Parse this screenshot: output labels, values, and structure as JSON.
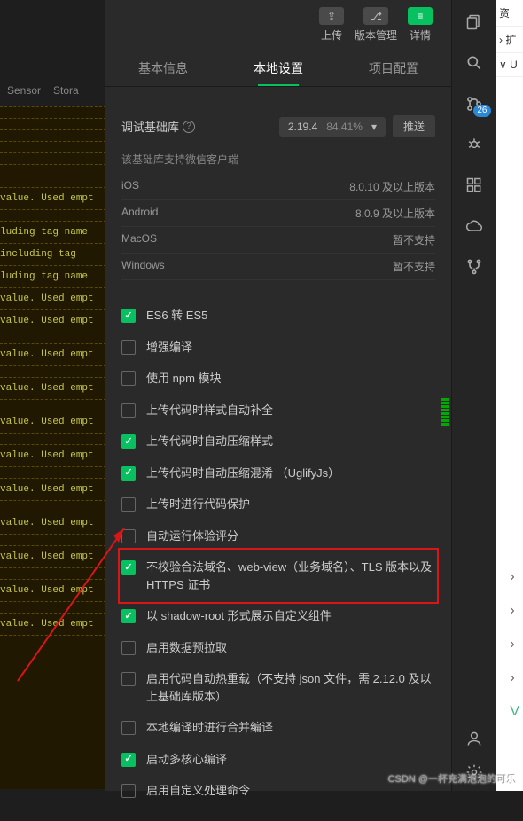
{
  "bgHeader": {
    "c1": "Sensor",
    "c2": "Stora"
  },
  "bgLines": [
    "",
    "",
    "",
    "",
    "",
    "",
    "",
    "value. Used empt",
    "",
    "luding tag name",
    " including tag ",
    "luding tag name",
    "value. Used empt",
    "value. Used empt",
    "",
    "value. Used empt",
    "",
    "value. Used empt",
    "",
    "value. Used empt",
    "",
    "value. Used empt",
    "",
    "value. Used empt",
    "",
    "value. Used empt",
    "",
    "value. Used empt",
    "",
    "value. Used empt",
    "",
    "value. Used empt",
    ""
  ],
  "toolbar": {
    "upload": "上传",
    "version": "版本管理",
    "detail": "详情"
  },
  "tabs": {
    "basic": "基本信息",
    "local": "本地设置",
    "project": "项目配置"
  },
  "debug": {
    "label": "调试基础库",
    "version": "2.19.4",
    "percent": "84.41%",
    "push": "推送"
  },
  "supportText": "该基础库支持微信客户端",
  "platforms": [
    {
      "name": "iOS",
      "req": "8.0.10 及以上版本"
    },
    {
      "name": "Android",
      "req": "8.0.9 及以上版本"
    },
    {
      "name": "MacOS",
      "req": "暂不支持"
    },
    {
      "name": "Windows",
      "req": "暂不支持"
    }
  ],
  "checks": [
    {
      "on": true,
      "label": "ES6 转 ES5"
    },
    {
      "on": false,
      "label": "增强编译"
    },
    {
      "on": false,
      "label": "使用 npm 模块"
    },
    {
      "on": false,
      "label": "上传代码时样式自动补全"
    },
    {
      "on": true,
      "label": "上传代码时自动压缩样式"
    },
    {
      "on": true,
      "label": "上传代码时自动压缩混淆 （UglifyJs）"
    },
    {
      "on": false,
      "label": "上传时进行代码保护"
    },
    {
      "on": false,
      "label": "自动运行体验评分"
    },
    {
      "on": true,
      "label": "不校验合法域名、web-view（业务域名）、TLS 版本以及 HTTPS 证书",
      "highlight": true
    },
    {
      "on": true,
      "label": "以 shadow-root 形式展示自定义组件"
    },
    {
      "on": false,
      "label": "启用数据预拉取"
    },
    {
      "on": false,
      "label": "启用代码自动热重载（不支持 json 文件，需 2.12.0 及以上基础库版本）"
    },
    {
      "on": false,
      "label": "本地编译时进行合并编译"
    },
    {
      "on": true,
      "label": "启动多核心编译"
    },
    {
      "on": false,
      "label": "启用自定义处理命令"
    }
  ],
  "rightRail": {
    "badge": "26"
  },
  "farRight": {
    "zi": "资",
    "kuo": "› 扩",
    "u": "∨ U"
  },
  "watermark": "CSDN @一杯充满泡泡的可乐"
}
